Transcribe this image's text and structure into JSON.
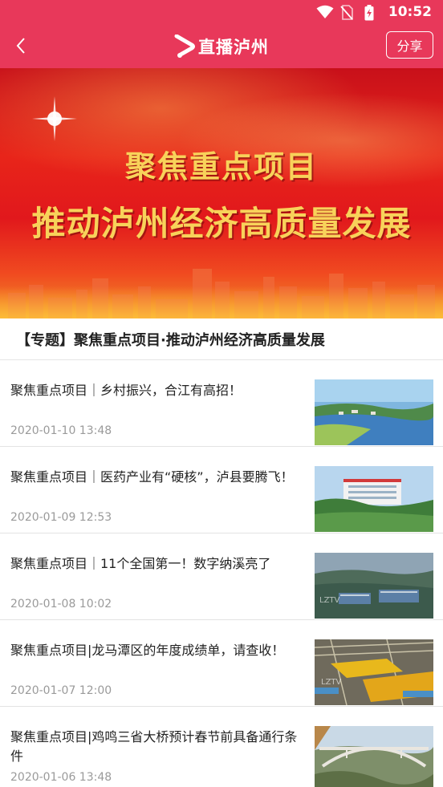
{
  "status_bar": {
    "time": "10:52"
  },
  "header": {
    "title": "直播泸州",
    "share_label": "分享"
  },
  "banner": {
    "line1": "聚焦重点项目",
    "line2": "推动泸州经济高质量发展"
  },
  "special": {
    "title": "【专题】聚焦重点项目·推动泸州经济高质量发展"
  },
  "articles": [
    {
      "title": "聚焦重点项目｜乡村振兴，合江有高招！",
      "date": "2020-01-10 13:48"
    },
    {
      "title": "聚焦重点项目｜医药产业有“硬核”，泸县要腾飞！",
      "date": "2020-01-09 12:53"
    },
    {
      "title": "聚焦重点项目｜11个全国第一！数字纳溪亮了",
      "date": "2020-01-08 10:02"
    },
    {
      "title": "聚焦重点项目|龙马潭区的年度成绩单，请查收！",
      "date": "2020-01-07 12:00"
    },
    {
      "title": "聚焦重点项目|鸡鸣三省大桥预计春节前具备通行条件",
      "date": "2020-01-06 13:48"
    }
  ],
  "colors": {
    "header_bg": "#e8385a",
    "banner_text": "#f8d25a"
  },
  "icons": [
    "wifi-icon",
    "no-sim-icon",
    "battery-charging-icon",
    "back-arrow-icon",
    "logo-play-icon"
  ]
}
